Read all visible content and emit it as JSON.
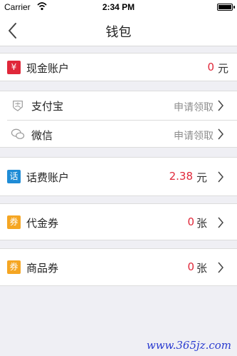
{
  "status_bar": {
    "carrier": "Carrier",
    "time": "2:34 PM"
  },
  "nav": {
    "title": "钱包"
  },
  "cash_account": {
    "icon_char": "¥",
    "label": "现金账户",
    "amount": "0",
    "unit": "元"
  },
  "third_party": {
    "alipay": {
      "label": "支付宝",
      "action": "申请领取"
    },
    "wechat": {
      "label": "微信",
      "action": "申请领取"
    }
  },
  "phone_account": {
    "icon_char": "话",
    "label": "话费账户",
    "amount": "2.38",
    "unit": "元"
  },
  "voucher": {
    "icon_char": "券",
    "label": "代金券",
    "amount": "0",
    "unit": "张"
  },
  "goods_coupon": {
    "icon_char": "券",
    "label": "商品券",
    "amount": "0",
    "unit": "张"
  },
  "watermark": "www.365jz.com",
  "colors": {
    "red": "#e0283a",
    "blue": "#1f8cd6",
    "orange": "#f5a623",
    "background": "#efeff4"
  }
}
